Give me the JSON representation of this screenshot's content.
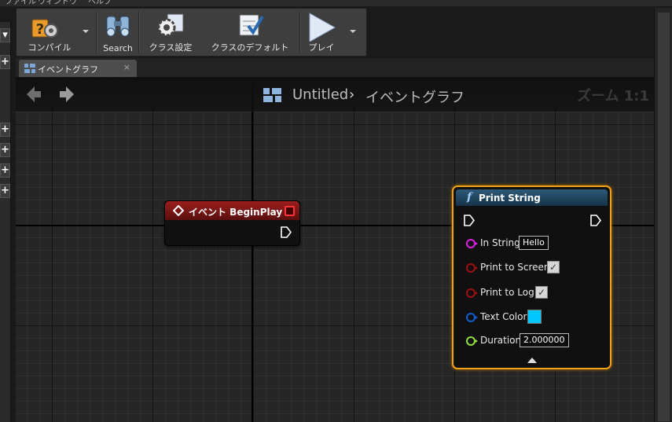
{
  "menu": {
    "items": [
      "ファイル",
      "ウィンドウ",
      "ヘルプ"
    ]
  },
  "toolbar": {
    "compile_label": "コンパイル",
    "search_label": "Search",
    "class_settings_label": "クラス設定",
    "class_defaults_label": "クラスのデフォルト",
    "play_label": "プレイ"
  },
  "tab": {
    "label": "イベントグラフ",
    "close": "×"
  },
  "graph": {
    "breadcrumb_root": "Untitled",
    "breadcrumb_sep": "›",
    "breadcrumb_page": "イベントグラフ",
    "zoom": "ズーム 1:1"
  },
  "event_node": {
    "title": "イベント BeginPlay",
    "header_color": "#8b1a1a"
  },
  "print_node": {
    "title": "Print String",
    "pins": [
      {
        "label": "In String",
        "value": "Hello",
        "pin_color": "#e020e0"
      },
      {
        "label": "Print to Screen",
        "checked": true,
        "check": "✓",
        "pin_color": "#a01010"
      },
      {
        "label": "Print to Log",
        "checked": true,
        "check": "✓",
        "pin_color": "#a01010"
      },
      {
        "label": "Text Color",
        "color": "#00c8ff",
        "pin_color": "#1060d0"
      },
      {
        "label": "Duration",
        "value": "2.000000",
        "pin_color": "#90e040"
      }
    ],
    "border_color": "#f2a316",
    "header_color": "#1f4a66"
  },
  "icons": [
    "compile-icon",
    "search-binoculars-icon",
    "class-settings-icon",
    "class-defaults-icon",
    "play-icon",
    "back-arrow-icon",
    "forward-arrow-icon",
    "graph-icon",
    "function-icon",
    "event-diamond-icon",
    "delegate-pin-icon",
    "exec-pin-icon",
    "expand-arrow-icon"
  ]
}
